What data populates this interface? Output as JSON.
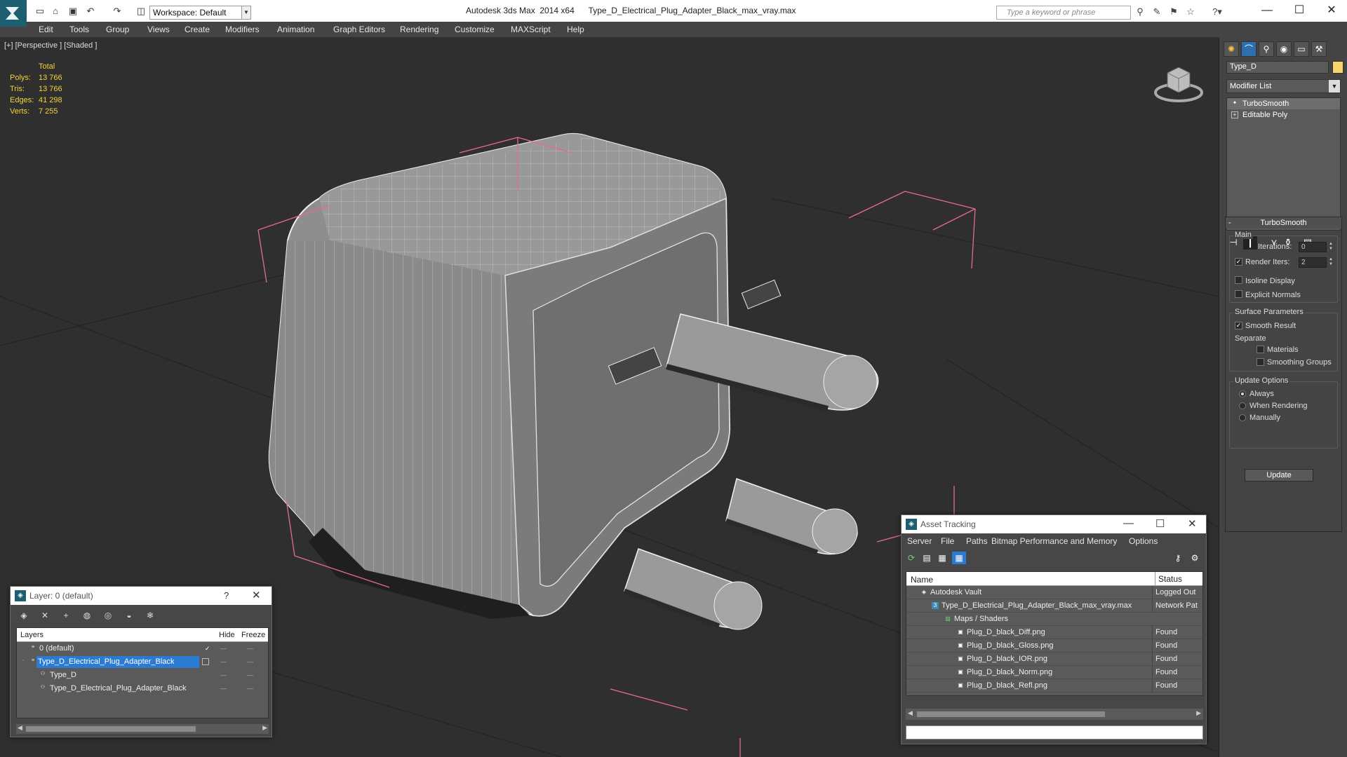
{
  "title": {
    "app": "Autodesk 3ds Max  2014 x64",
    "file": "Type_D_Electrical_Plug_Adapter_Black_max_vray.max",
    "workspace": "Workspace: Default",
    "search_placeholder": "Type a keyword or phrase"
  },
  "menu": [
    "Edit",
    "Tools",
    "Group",
    "Views",
    "Create",
    "Modifiers",
    "Animation",
    "Graph Editors",
    "Rendering",
    "Customize",
    "MAXScript",
    "Help"
  ],
  "viewport": {
    "label": "[+] [Perspective ] [Shaded ]",
    "stats": {
      "header": "Total",
      "polys_label": "Polys:",
      "polys": "13 766",
      "tris_label": "Tris:",
      "tris": "13 766",
      "edges_label": "Edges:",
      "edges": "41 298",
      "verts_label": "Verts:",
      "verts": "7 255"
    }
  },
  "command_panel": {
    "object_name": "Type_D",
    "object_color": "#f7d56b",
    "modifier_list": "Modifier List",
    "stack": [
      "TurboSmooth",
      "Editable Poly"
    ],
    "rollout_title": "TurboSmooth",
    "main_group": "Main",
    "iterations_label": "Iterations:",
    "iterations": "0",
    "render_iters_label": "Render Iters:",
    "render_iters": "2",
    "isoline": "Isoline Display",
    "explicit_normals": "Explicit Normals",
    "surface_group": "Surface Parameters",
    "smooth_result": "Smooth Result",
    "separate": "Separate",
    "materials": "Materials",
    "smoothing_groups": "Smoothing Groups",
    "update_group": "Update Options",
    "always": "Always",
    "when_rendering": "When Rendering",
    "manually": "Manually",
    "update_button": "Update"
  },
  "layer_panel": {
    "title": "Layer: 0 (default)",
    "help": "?",
    "col_layers": "Layers",
    "col_hide": "Hide",
    "col_freeze": "Freeze",
    "rows": [
      "0 (default)",
      "Type_D_Electrical_Plug_Adapter_Black",
      "Type_D",
      "Type_D_Electrical_Plug_Adapter_Black"
    ]
  },
  "asset_panel": {
    "title": "Asset Tracking",
    "menu": [
      "Server",
      "File",
      "Paths",
      "Bitmap Performance and Memory",
      "Options"
    ],
    "col_name": "Name",
    "col_status": "Status",
    "rows": [
      {
        "name": "Autodesk Vault",
        "status": "Logged Out"
      },
      {
        "name": "Type_D_Electrical_Plug_Adapter_Black_max_vray.max",
        "status": "Network Pat"
      },
      {
        "name": "Maps / Shaders",
        "status": ""
      },
      {
        "name": "Plug_D_black_Diff.png",
        "status": "Found"
      },
      {
        "name": "Plug_D_black_Gloss.png",
        "status": "Found"
      },
      {
        "name": "Plug_D_black_IOR.png",
        "status": "Found"
      },
      {
        "name": "Plug_D_black_Norm.png",
        "status": "Found"
      },
      {
        "name": "Plug_D_black_Refl.png",
        "status": "Found"
      }
    ]
  }
}
